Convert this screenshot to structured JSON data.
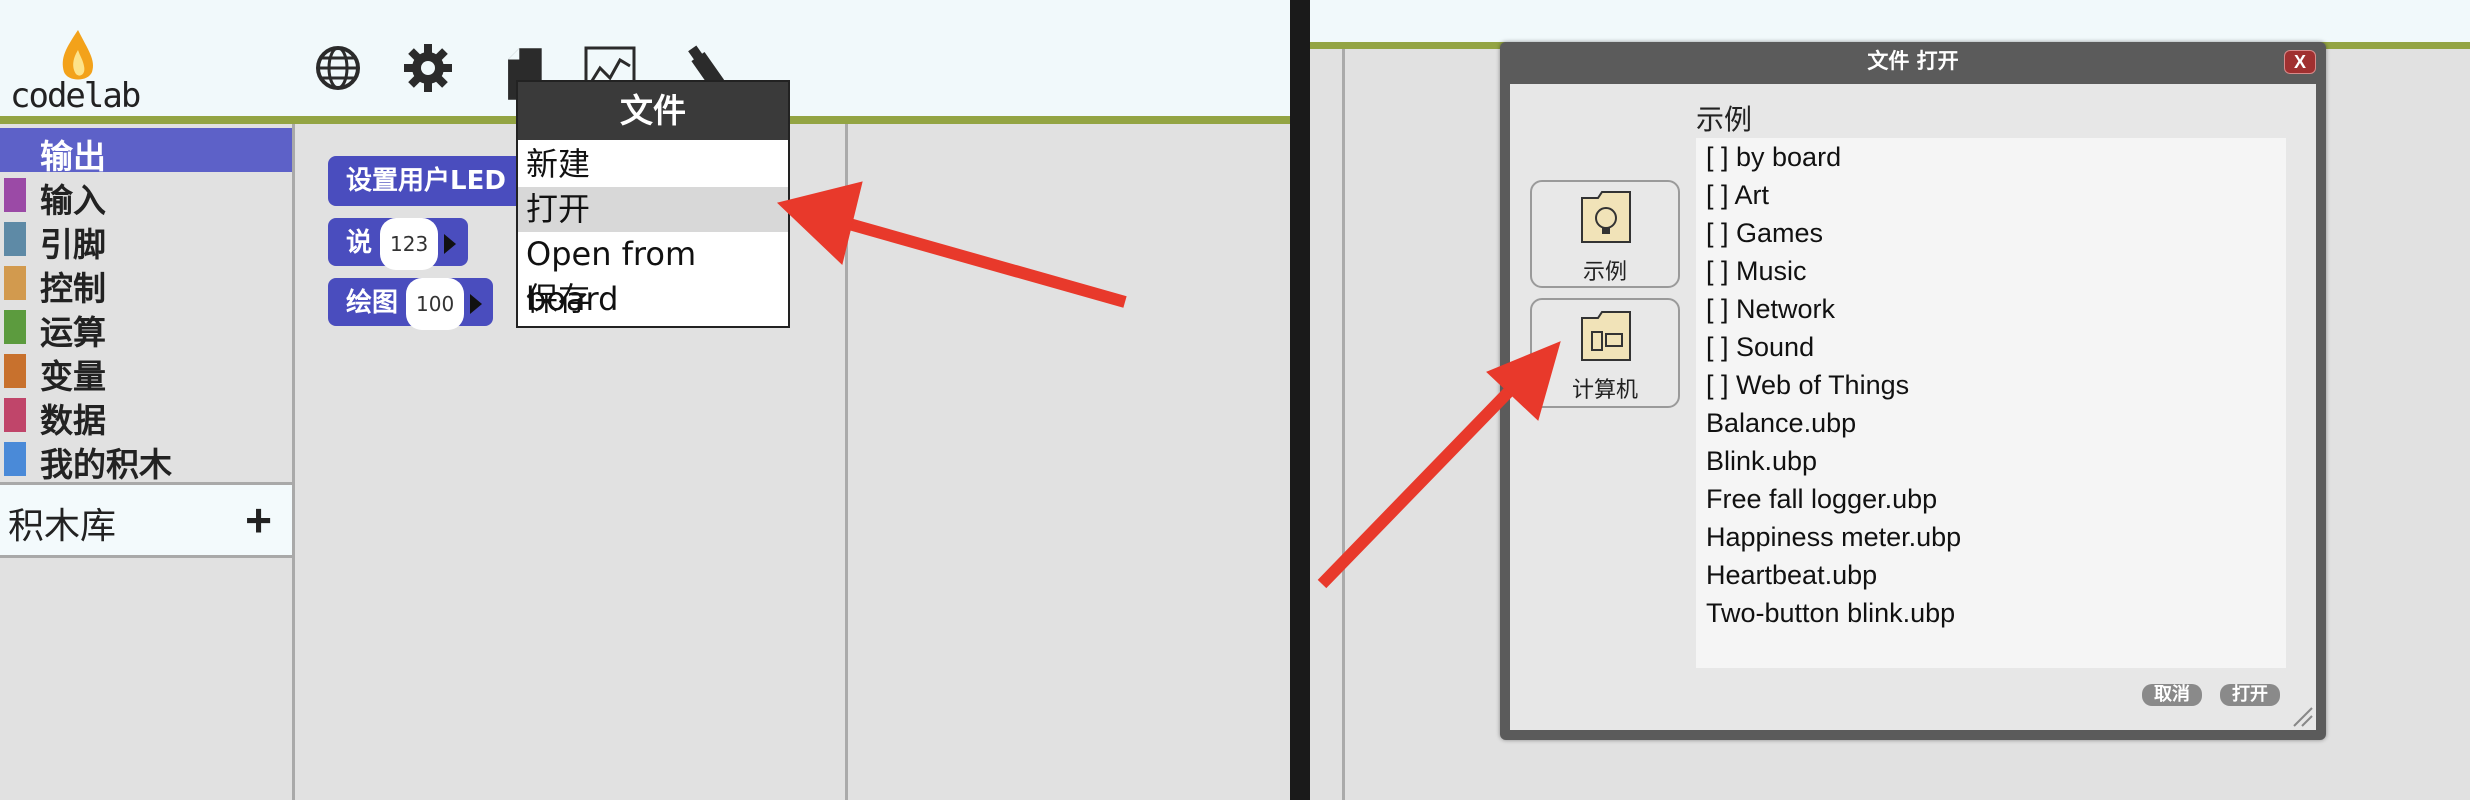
{
  "left": {
    "logo_text": "codelab",
    "toolbar_icons": [
      "globe-icon",
      "gear-icon",
      "file-icon",
      "graph-icon",
      "usb-icon"
    ],
    "categories": [
      {
        "label": "输出",
        "color": "#5d61c8",
        "selected": true
      },
      {
        "label": "输入",
        "color": "#9b4aa6"
      },
      {
        "label": "引脚",
        "color": "#5e8aa6"
      },
      {
        "label": "控制",
        "color": "#d29a4e"
      },
      {
        "label": "运算",
        "color": "#5c9b3e"
      },
      {
        "label": "变量",
        "color": "#c8712d"
      },
      {
        "label": "数据",
        "color": "#c0456a"
      },
      {
        "label": "我的积木",
        "color": "#4a8ad8"
      }
    ],
    "library_label": "积木库",
    "library_add": "+",
    "blocks": [
      {
        "label": "设置用户LED"
      },
      {
        "label": "说",
        "value": "123"
      },
      {
        "label": "绘图",
        "value": "100"
      }
    ],
    "menu": {
      "title": "文件",
      "items": [
        "新建",
        "打开",
        "Open from board",
        "保存"
      ],
      "highlighted_index": 1
    }
  },
  "dialog": {
    "title": "文件 打开",
    "close_label": "X",
    "section_label": "示例",
    "sources": [
      {
        "label": "示例",
        "icon": "lightbulb-folder-icon"
      },
      {
        "label": "计算机",
        "icon": "computer-folder-icon"
      }
    ],
    "files": [
      "[ ]  by board",
      "[ ] Art",
      "[ ] Games",
      "[ ] Music",
      "[ ] Network",
      "[ ] Sound",
      "[ ] Web of Things",
      "Balance.ubp",
      "Blink.ubp",
      "Free fall logger.ubp",
      "Happiness meter.ubp",
      "Heartbeat.ubp",
      "Two-button blink.ubp"
    ],
    "cancel_label": "取消",
    "open_label": "打开"
  },
  "colors": {
    "accent_green": "#93a443",
    "annotation_arrow": "#e8392b",
    "block_blue": "#4a4dbe"
  }
}
